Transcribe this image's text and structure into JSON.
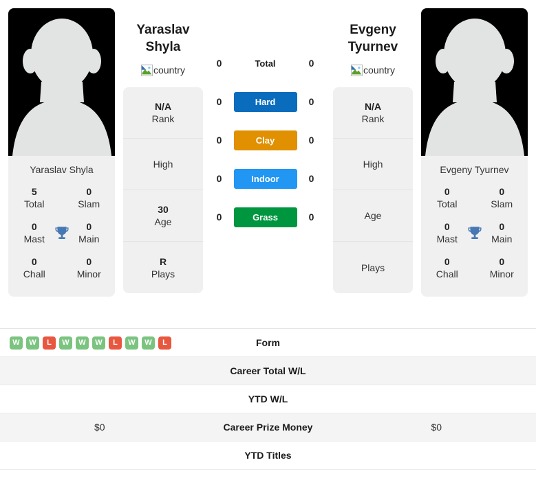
{
  "players": {
    "left": {
      "display_name": "Yaraslav Shyla",
      "name_line1": "Yaraslav",
      "name_line2": "Shyla",
      "country_alt": "country",
      "photo_alt": "player photo",
      "titles": [
        {
          "value": "5",
          "label": "Total"
        },
        {
          "value": "0",
          "label": "Slam"
        },
        {
          "value": "0",
          "label": "Mast"
        },
        {
          "value": "0",
          "label": "Main"
        },
        {
          "value": "0",
          "label": "Chall"
        },
        {
          "value": "0",
          "label": "Minor"
        }
      ],
      "info": [
        {
          "value": "N/A",
          "label": "Rank"
        },
        {
          "value": "",
          "label": "High"
        },
        {
          "value": "30",
          "label": "Age"
        },
        {
          "value": "R",
          "label": "Plays"
        }
      ]
    },
    "right": {
      "display_name": "Evgeny Tyurnev",
      "name_line1": "Evgeny",
      "name_line2": "Tyurnev",
      "country_alt": "country",
      "photo_alt": "player photo",
      "titles": [
        {
          "value": "0",
          "label": "Total"
        },
        {
          "value": "0",
          "label": "Slam"
        },
        {
          "value": "0",
          "label": "Mast"
        },
        {
          "value": "0",
          "label": "Main"
        },
        {
          "value": "0",
          "label": "Chall"
        },
        {
          "value": "0",
          "label": "Minor"
        }
      ],
      "info": [
        {
          "value": "N/A",
          "label": "Rank"
        },
        {
          "value": "",
          "label": "High"
        },
        {
          "value": "",
          "label": "Age"
        },
        {
          "value": "",
          "label": "Plays"
        }
      ]
    }
  },
  "head_to_head": [
    {
      "label": "Total",
      "left": "0",
      "right": "0",
      "color": ""
    },
    {
      "label": "Hard",
      "left": "0",
      "right": "0",
      "color": "#0a6cbd"
    },
    {
      "label": "Clay",
      "left": "0",
      "right": "0",
      "color": "#e09000"
    },
    {
      "label": "Indoor",
      "left": "0",
      "right": "0",
      "color": "#2196f3"
    },
    {
      "label": "Grass",
      "left": "0",
      "right": "0",
      "color": "#009640"
    }
  ],
  "comparison": [
    {
      "label": "Form",
      "left": "",
      "right": "",
      "form": [
        "W",
        "W",
        "L",
        "W",
        "W",
        "W",
        "L",
        "W",
        "W",
        "L"
      ]
    },
    {
      "label": "Career Total W/L",
      "left": "",
      "right": ""
    },
    {
      "label": "YTD W/L",
      "left": "",
      "right": ""
    },
    {
      "label": "Career Prize Money",
      "left": "$0",
      "right": "$0"
    },
    {
      "label": "YTD Titles",
      "left": "",
      "right": ""
    }
  ],
  "colors": {
    "win": "#7bc47f",
    "loss": "#e8573f",
    "trophy": "#4678b4",
    "card_bg": "#f0f0f0",
    "row_shade": "#f4f4f4"
  }
}
